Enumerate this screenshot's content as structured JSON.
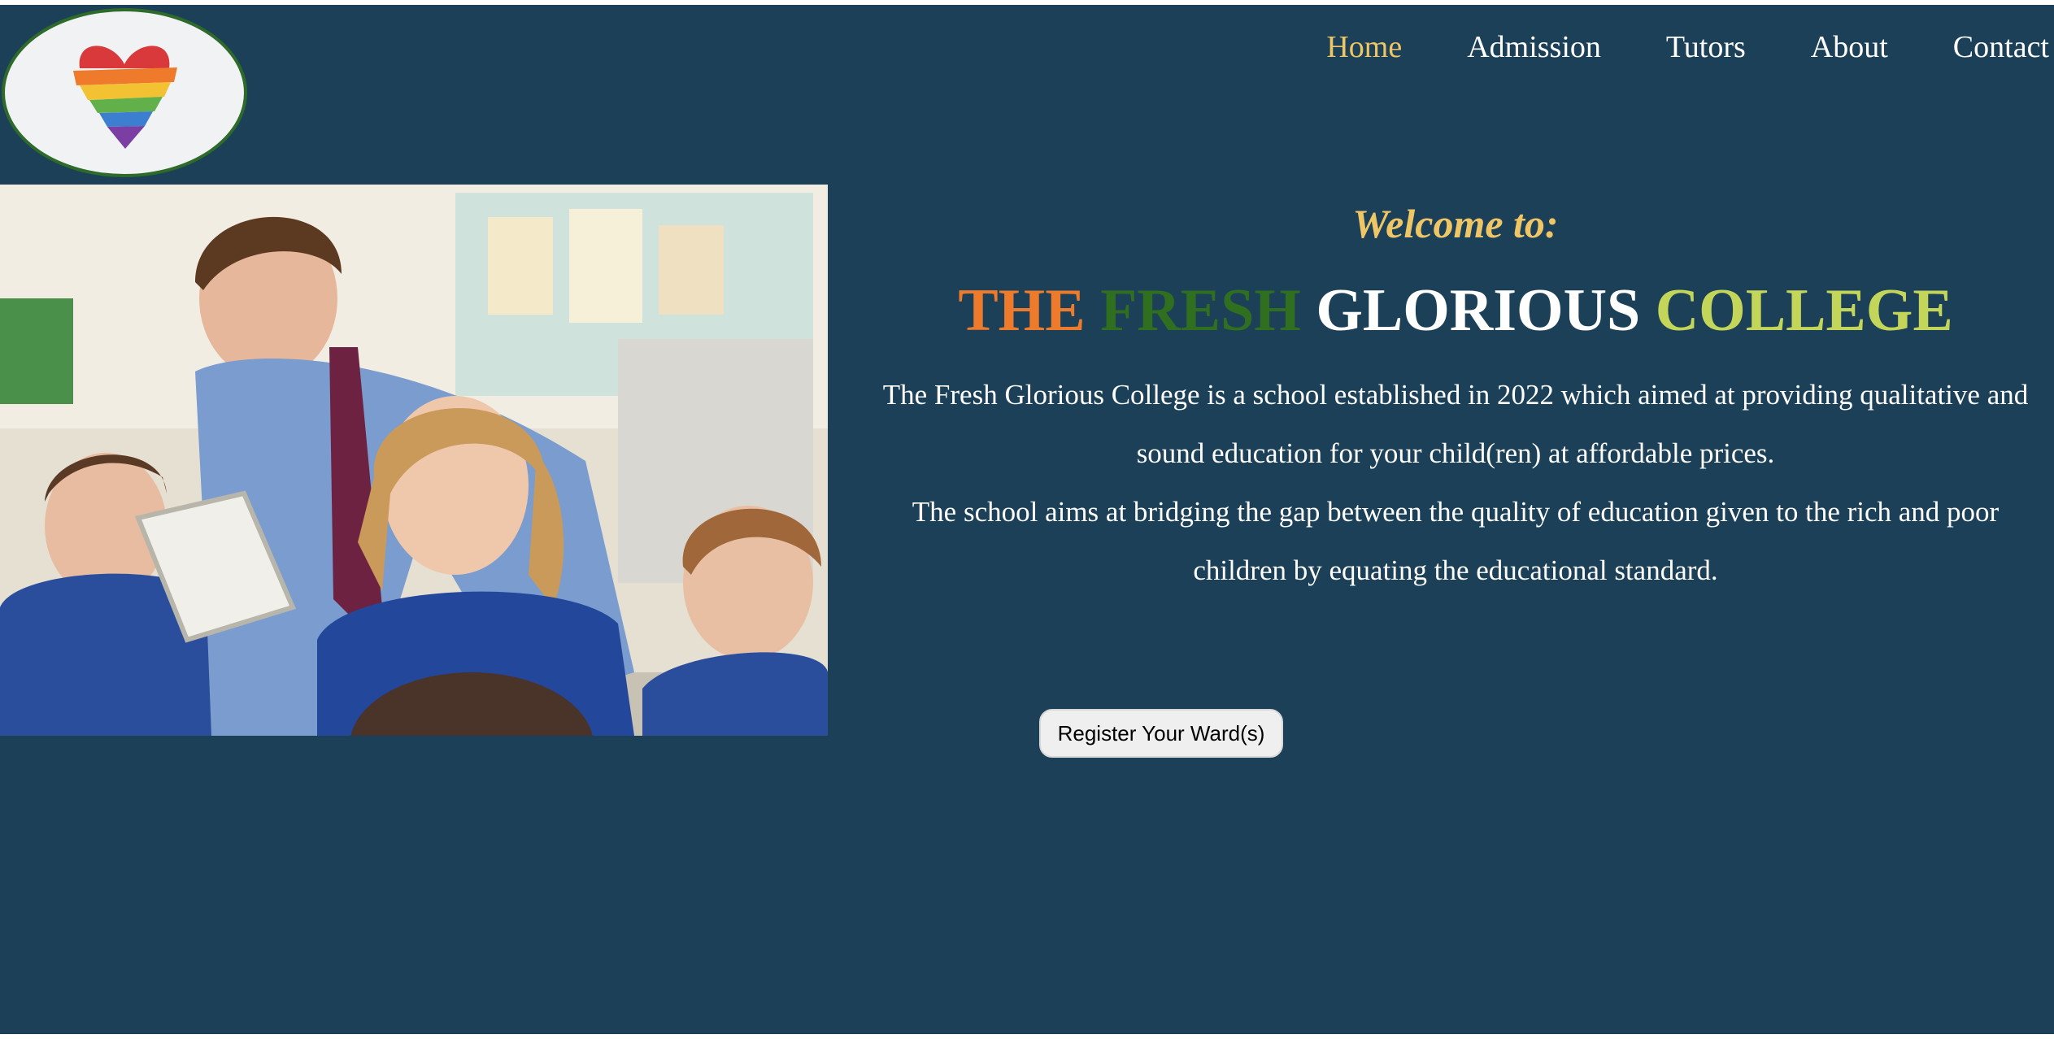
{
  "nav": {
    "items": [
      {
        "label": "Home",
        "active": true
      },
      {
        "label": "Admission",
        "active": false
      },
      {
        "label": "Tutors",
        "active": false
      },
      {
        "label": "About",
        "active": false
      },
      {
        "label": "Contact",
        "active": false
      }
    ]
  },
  "hero": {
    "welcome": "Welcome to:",
    "title_words": [
      "THE",
      "FRESH",
      "GLORIOUS",
      "COLLEGE"
    ],
    "paragraphs": [
      "The Fresh Glorious College is a school established in 2022 which aimed at providing qualitative and sound education for your child(ren) at affordable prices.",
      "The school aims at bridging the gap between the quality of education given to the rich and poor children by equating the educational standard."
    ],
    "register_label": "Register Your Ward(s)"
  },
  "colors": {
    "background": "#1b4057",
    "accent_gold": "#efc666",
    "title_orange": "#ee7a2c",
    "title_green": "#2f6f1f",
    "title_white": "#ffffff",
    "title_lime": "#c4d65a",
    "logo_border": "#2e6b2a"
  },
  "icons": {
    "logo": "rainbow-heart-icon",
    "photo": "classroom-teacher-students-photo"
  }
}
